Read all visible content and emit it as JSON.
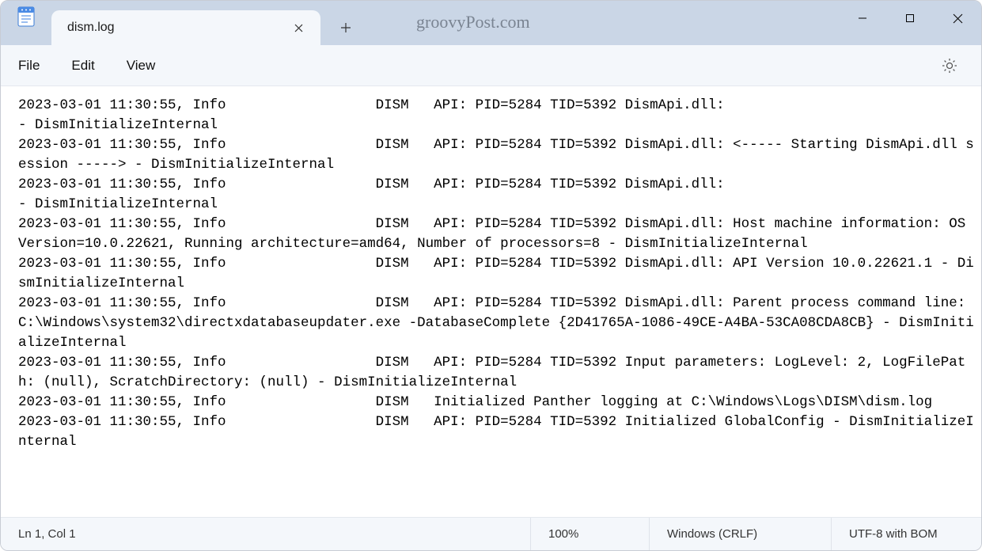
{
  "tab": {
    "title": "dism.log"
  },
  "watermark": "groovyPost.com",
  "menus": {
    "file": "File",
    "edit": "Edit",
    "view": "View"
  },
  "editor": {
    "text": "2023-03-01 11:30:55, Info                  DISM   API: PID=5284 TID=5392 DismApi.dll:                                            - DismInitializeInternal\n2023-03-01 11:30:55, Info                  DISM   API: PID=5284 TID=5392 DismApi.dll: <----- Starting DismApi.dll session -----> - DismInitializeInternal\n2023-03-01 11:30:55, Info                  DISM   API: PID=5284 TID=5392 DismApi.dll:                                            - DismInitializeInternal\n2023-03-01 11:30:55, Info                  DISM   API: PID=5284 TID=5392 DismApi.dll: Host machine information: OS Version=10.0.22621, Running architecture=amd64, Number of processors=8 - DismInitializeInternal\n2023-03-01 11:30:55, Info                  DISM   API: PID=5284 TID=5392 DismApi.dll: API Version 10.0.22621.1 - DismInitializeInternal\n2023-03-01 11:30:55, Info                  DISM   API: PID=5284 TID=5392 DismApi.dll: Parent process command line: C:\\Windows\\system32\\directxdatabaseupdater.exe -DatabaseComplete {2D41765A-1086-49CE-A4BA-53CA08CDA8CB} - DismInitializeInternal\n2023-03-01 11:30:55, Info                  DISM   API: PID=5284 TID=5392 Input parameters: LogLevel: 2, LogFilePath: (null), ScratchDirectory: (null) - DismInitializeInternal\n2023-03-01 11:30:55, Info                  DISM   Initialized Panther logging at C:\\Windows\\Logs\\DISM\\dism.log\n2023-03-01 11:30:55, Info                  DISM   API: PID=5284 TID=5392 Initialized GlobalConfig - DismInitializeInternal\n"
  },
  "status": {
    "position": "Ln 1, Col 1",
    "zoom": "100%",
    "line_ending": "Windows (CRLF)",
    "encoding": "UTF-8 with BOM"
  }
}
